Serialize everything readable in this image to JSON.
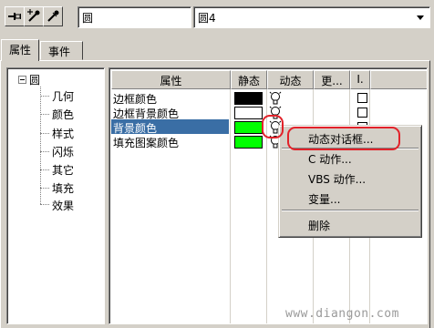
{
  "toolbar": {
    "buttons": [
      {
        "icon": "pin-icon"
      },
      {
        "icon": "dropper-plus-icon"
      },
      {
        "icon": "dropper-icon"
      }
    ],
    "object_type": "圆",
    "object_name": "圆4"
  },
  "tabs": [
    {
      "label": "属性",
      "active": true
    },
    {
      "label": "事件",
      "active": false
    }
  ],
  "tree": {
    "root": "圆",
    "items": [
      "几何",
      "颜色",
      "样式",
      "闪烁",
      "其它",
      "填充",
      "效果"
    ]
  },
  "grid": {
    "headers": [
      "属性",
      "静态",
      "动态",
      "更...",
      "I."
    ],
    "rows": [
      {
        "label": "边框颜色",
        "color": "#000000",
        "selected": false
      },
      {
        "label": "边框背景颜色",
        "color": "#ffffff",
        "selected": false
      },
      {
        "label": "背景颜色",
        "color": "#00ff00",
        "selected": true
      },
      {
        "label": "填充图案颜色",
        "color": "#00ff00",
        "selected": false
      }
    ]
  },
  "context_menu": {
    "items": [
      "动态对话框...",
      "C 动作...",
      "VBS 动作...",
      "变量...",
      "删除"
    ]
  },
  "colors": {
    "highlight_ring": "#e2222a",
    "selection": "#3a6ea5",
    "face": "#d4d0c8"
  },
  "watermark": "www.diangon.com"
}
